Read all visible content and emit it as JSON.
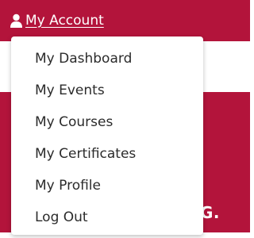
{
  "colors": {
    "brand": "#b3143b",
    "menu_bg": "#ffffff",
    "menu_text": "#2b2b2b"
  },
  "header": {
    "account_icon": "user-icon",
    "account_label": "My Account"
  },
  "account_menu": {
    "items": [
      {
        "label": "My Dashboard"
      },
      {
        "label": "My Events"
      },
      {
        "label": "My Courses"
      },
      {
        "label": "My Certificates"
      },
      {
        "label": "My Profile"
      },
      {
        "label": "Log Out"
      }
    ]
  },
  "hero": {
    "partial_text": "G."
  }
}
